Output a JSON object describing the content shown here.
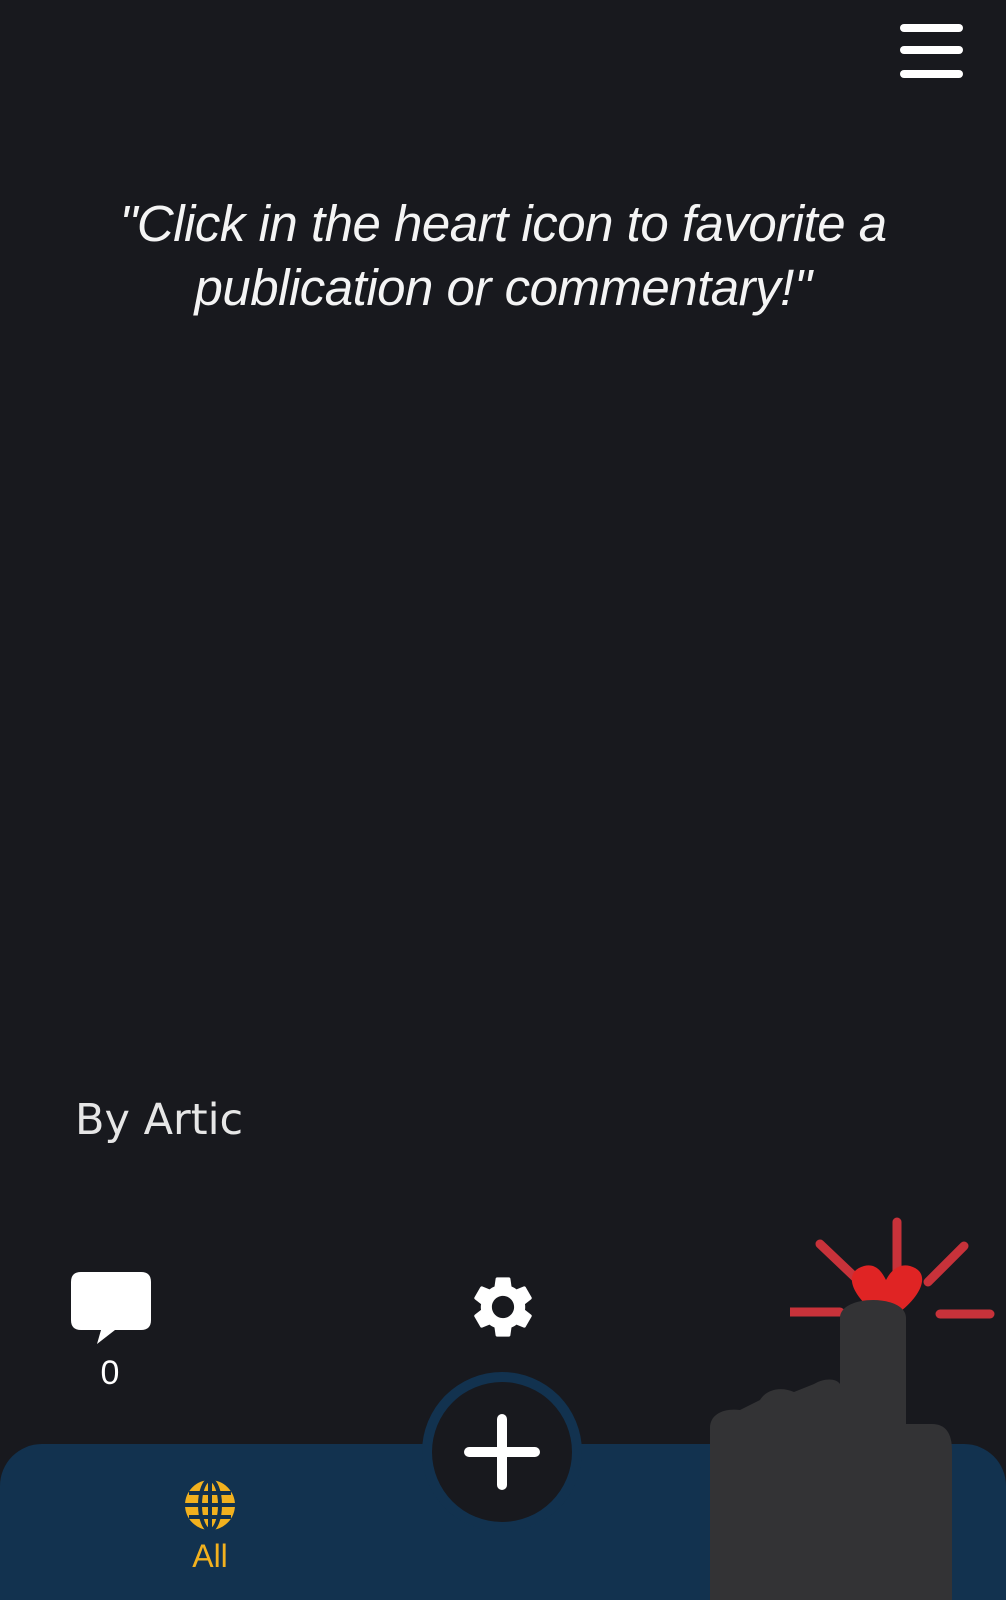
{
  "post": {
    "quote": "\"Click in the heart   icon to favorite a publication or commentary!\"",
    "author": "By Artic",
    "comment_count": "0"
  },
  "nav": {
    "tab_all_label": "All"
  },
  "icons": {
    "menu": "hamburger-menu-icon",
    "comment": "speech-bubble-icon",
    "settings": "gear-icon",
    "add": "plus-icon",
    "tab_all": "globe-icon",
    "hint": "heart-icon"
  },
  "colors": {
    "background": "#18191e",
    "bottom_bar": "#12324f",
    "accent": "#f2b11e",
    "heart": "#e02424",
    "burst": "#c8323a",
    "hand": "#333335"
  }
}
